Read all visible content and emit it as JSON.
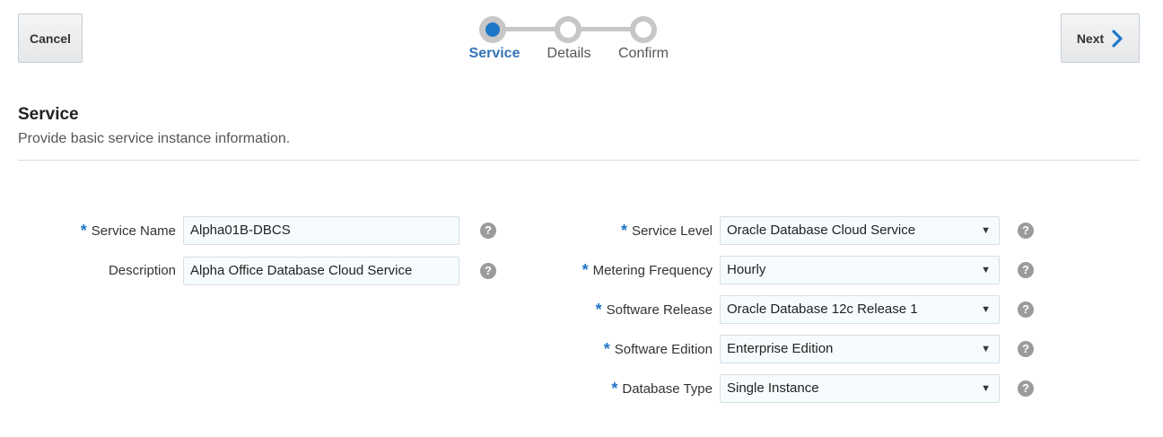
{
  "toolbar": {
    "cancel_label": "Cancel",
    "next_label": "Next"
  },
  "train": {
    "steps": [
      {
        "label": "Service",
        "active": true
      },
      {
        "label": "Details",
        "active": false
      },
      {
        "label": "Confirm",
        "active": false
      }
    ]
  },
  "section": {
    "title": "Service",
    "description": "Provide basic service instance information."
  },
  "left_form": {
    "service_name": {
      "label": "Service Name",
      "required": true,
      "value": "Alpha01B-DBCS"
    },
    "description": {
      "label": "Description",
      "required": false,
      "value": "Alpha Office Database Cloud Service"
    }
  },
  "right_form": {
    "service_level": {
      "label": "Service Level",
      "required": true,
      "value": "Oracle Database Cloud Service"
    },
    "metering_frequency": {
      "label": "Metering Frequency",
      "required": true,
      "value": "Hourly"
    },
    "software_release": {
      "label": "Software Release",
      "required": true,
      "value": "Oracle Database 12c Release 1"
    },
    "software_edition": {
      "label": "Software Edition",
      "required": true,
      "value": "Enterprise Edition"
    },
    "database_type": {
      "label": "Database Type",
      "required": true,
      "value": "Single Instance"
    }
  },
  "icons": {
    "help": "question-circle-icon",
    "next": "chevron-right-icon",
    "dropdown": "caret-down-icon"
  },
  "colors": {
    "accent": "#1f76c6",
    "active_step_text": "#3574b6",
    "help_icon": "#9b9b9b",
    "field_bg": "#f6fbfe"
  }
}
